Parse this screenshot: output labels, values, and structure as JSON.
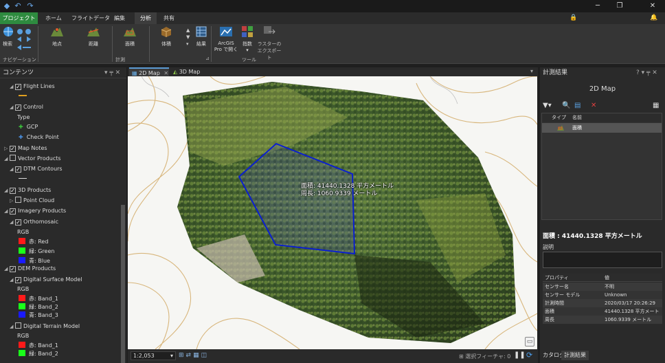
{
  "ribbon_tabs": [
    "プロジェクト",
    "ホーム",
    "フライトデータ",
    "編集",
    "分析",
    "共有"
  ],
  "active_tab": "分析",
  "ribbon": {
    "search_label": "検索",
    "navigation_group": "ナビゲーション",
    "measure_group": "計測",
    "tools_group": "ツール",
    "buttons": {
      "point": "地点",
      "distance": "距離",
      "area": "面積",
      "volume": "体積",
      "results": "結果",
      "arcgis_pro_l1": "ArcGIS",
      "arcgis_pro_l2": "Pro で開く",
      "index_l1": "指数",
      "raster_l1": "ラスターの",
      "raster_l2": "エクスポート"
    }
  },
  "contents": {
    "title": "コンテンツ",
    "rows": [
      {
        "label": "Flight Lines"
      },
      {
        "label": "Control"
      },
      {
        "label": "Type"
      },
      {
        "label": "GCP"
      },
      {
        "label": "Check Point"
      },
      {
        "label": "Map Notes"
      },
      {
        "label": "Vector Products"
      },
      {
        "label": "DTM Contours"
      },
      {
        "label": "3D Products"
      },
      {
        "label": "Point Cloud"
      },
      {
        "label": "Imagery Products"
      },
      {
        "label": "Orthomosaic"
      },
      {
        "label": "RGB"
      },
      {
        "label": "赤:  Red"
      },
      {
        "label": "緑:  Green"
      },
      {
        "label": "青:  Blue"
      },
      {
        "label": "DEM Products"
      },
      {
        "label": "Digital Surface Model"
      },
      {
        "label": "RGB"
      },
      {
        "label": "赤:  Band_1"
      },
      {
        "label": "緑:  Band_2"
      },
      {
        "label": "青:  Band_3"
      },
      {
        "label": "Digital Terrain Model"
      },
      {
        "label": "RGB"
      },
      {
        "label": "赤:  Band_1"
      },
      {
        "label": "緑:  Band_2"
      }
    ]
  },
  "map_tabs": [
    "2D Map",
    "3D Map"
  ],
  "map": {
    "label_area": "面積: 41440.1328 平方メートル",
    "label_perimeter": "周長: 1060.9339 メートル",
    "scale": "1:2,053",
    "selected_features": "選択フィーチャ: 0"
  },
  "measure": {
    "title": "計測結果",
    "subtitle": "2D Map",
    "col_type": "タイプ",
    "col_name": "名前",
    "row_name": "面積",
    "summary": "面積 : 41440.1328 平方メートル",
    "description_label": "説明",
    "props_header": [
      "プロパティ",
      "値"
    ],
    "props": [
      [
        "センサー名",
        "不明"
      ],
      [
        "センサー モデル",
        "Unknown"
      ],
      [
        "計測時間",
        "2020/03/17 20:26:29"
      ],
      [
        "面積",
        "41440.1328 平方メートル"
      ],
      [
        "周長",
        "1060.9339 メートル"
      ]
    ]
  },
  "bottom_tabs": [
    "カタログ",
    "計測結果"
  ]
}
